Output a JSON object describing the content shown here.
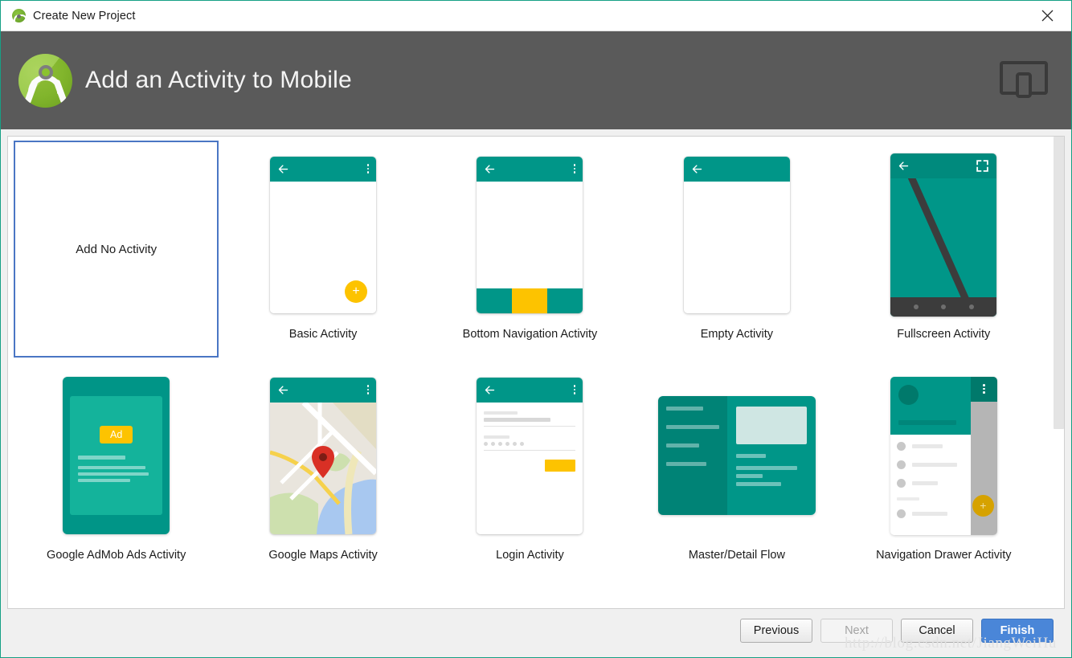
{
  "window": {
    "title": "Create New Project",
    "icon": "android-studio-icon",
    "close_label": "✕"
  },
  "header": {
    "title": "Add an Activity to Mobile",
    "logo": "android-studio-logo",
    "form_factor_icon": "mobile-device-icon",
    "background_color": "#5a5a5a"
  },
  "colors": {
    "teal": "#009688",
    "teal_dark": "#00796b",
    "amber": "#fdc300",
    "selection_blue": "#4a76c4",
    "primary_button": "#4a86d8"
  },
  "gallery": {
    "selected_index": 0,
    "items": [
      {
        "label": "Add No Activity",
        "thumb": "no-activity"
      },
      {
        "label": "Basic Activity",
        "thumb": "basic-activity"
      },
      {
        "label": "Bottom Navigation Activity",
        "thumb": "bottom-navigation-activity"
      },
      {
        "label": "Empty Activity",
        "thumb": "empty-activity"
      },
      {
        "label": "Fullscreen Activity",
        "thumb": "fullscreen-activity"
      },
      {
        "label": "Google AdMob Ads Activity",
        "thumb": "admob-activity",
        "badge": "Ad"
      },
      {
        "label": "Google Maps Activity",
        "thumb": "maps-activity"
      },
      {
        "label": "Login Activity",
        "thumb": "login-activity"
      },
      {
        "label": "Master/Detail Flow",
        "thumb": "master-detail-flow"
      },
      {
        "label": "Navigation Drawer Activity",
        "thumb": "navigation-drawer-activity"
      }
    ]
  },
  "scrollbar": {
    "thumb_position_percent": 0,
    "thumb_size_percent": 62
  },
  "footer": {
    "previous": "Previous",
    "next": "Next",
    "cancel": "Cancel",
    "finish": "Finish",
    "next_disabled": true
  },
  "watermark": {
    "text": "http://blog.csdn.net/JiangWeiHu"
  }
}
